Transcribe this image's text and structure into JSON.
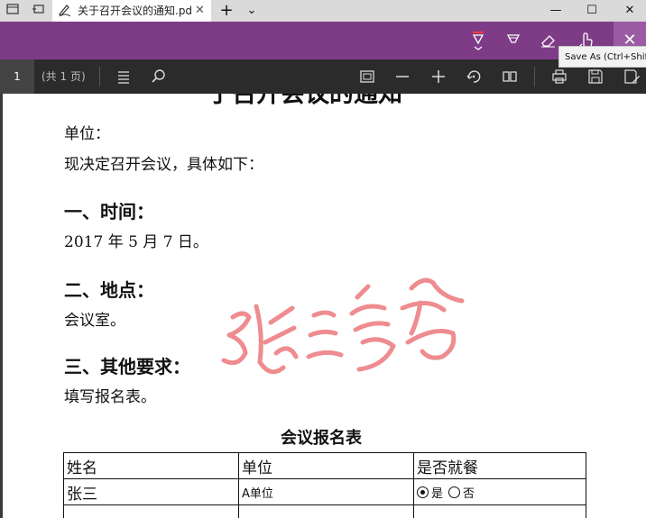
{
  "titlebar": {
    "tab_title": "关于召开会议的通知.pd",
    "new_tab_glyph": "+",
    "tabs_menu_glyph": "⌄",
    "minimize_glyph": "—",
    "maximize_glyph": "☐",
    "close_glyph": "✕",
    "tab_close_glyph": "✕"
  },
  "inkbar": {
    "tools": [
      "ballpoint-pen-icon",
      "highlighter-icon",
      "eraser-icon",
      "touch-writing-icon"
    ],
    "close_glyph": "✕",
    "tooltip": "Save As (Ctrl+Shift+S)",
    "accent_color": "#7e3c87"
  },
  "toolbar": {
    "page_number": "1",
    "page_count": "(共 1 页)",
    "icons": [
      "contents-icon",
      "search-icon",
      "fit-page-icon",
      "zoom-out-icon",
      "zoom-in-icon",
      "rotate-icon",
      "page-view-icon",
      "print-icon",
      "save-icon",
      "save-as-icon"
    ]
  },
  "document": {
    "title": "于召开会议的通知",
    "unit_line": "单位：",
    "intro": "现决定召开会议，具体如下：",
    "section1_heading": "一、时间：",
    "section1_body": "2017 年 5 月 7 日。",
    "section2_heading": "二、地点：",
    "section2_body": "会议室。",
    "section3_heading": "三、其他要求：",
    "section3_body": "填写报名表。",
    "form_title": "会议报名表",
    "table": {
      "headers": [
        "姓名",
        "单位",
        "是否就餐"
      ],
      "rows": [
        {
          "name": "张三",
          "unit": "A单位",
          "meal_yes": "是",
          "meal_no": "否",
          "selected": "是"
        }
      ]
    },
    "ink_color": "#ee8c8f"
  }
}
